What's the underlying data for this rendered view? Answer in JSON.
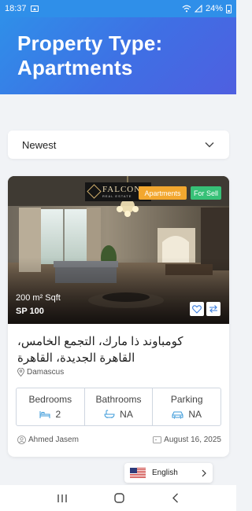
{
  "status_bar": {
    "time": "18:37",
    "battery": "24%"
  },
  "header": {
    "title_line1": "Property Type:",
    "title_line2": "Apartments"
  },
  "sort": {
    "selected": "Newest"
  },
  "listing": {
    "logo_name": "FALCON",
    "logo_sub": "REAL ESTATE",
    "type_badge": "Apartments",
    "status_badge": "For Sell",
    "area": "200 m² Sqft",
    "price": "SP 100",
    "title": "كومباوند ذا مارك، التجمع الخامس، القاهرة الجديدة، القاهرة",
    "location": "Damascus",
    "features": [
      {
        "label": "Bedrooms",
        "value": "2",
        "icon": "bed-icon"
      },
      {
        "label": "Bathrooms",
        "value": "NA",
        "icon": "bathtub-icon"
      },
      {
        "label": "Parking",
        "value": "NA",
        "icon": "car-icon"
      }
    ],
    "agent": "Ahmed Jasem",
    "date": "August 16, 2025"
  },
  "language": {
    "label": "English",
    "icon": "us-flag-icon"
  },
  "colors": {
    "header_start": "#2f8fe9",
    "header_end": "#4f5fe0",
    "type_badge": "#f2a72f",
    "status_badge": "#37c177"
  }
}
